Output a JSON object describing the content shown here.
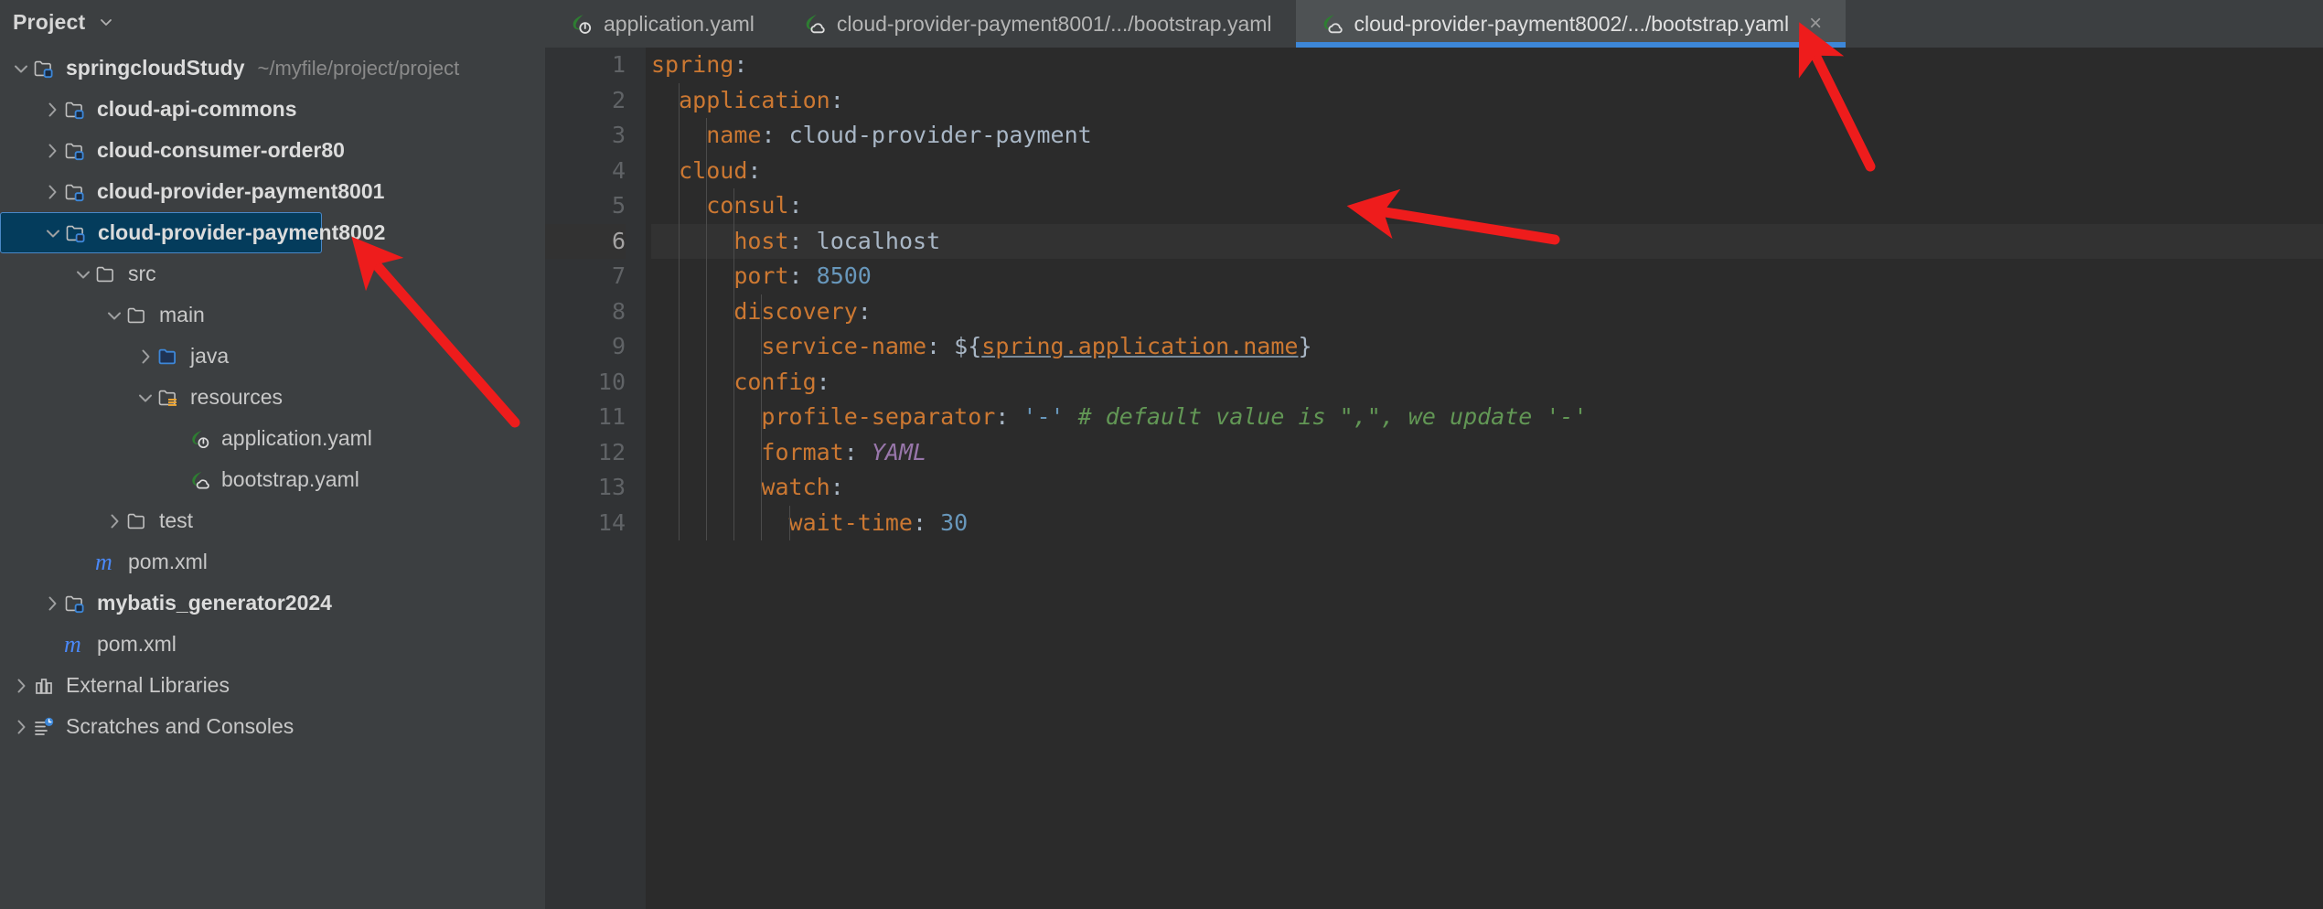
{
  "sidebar": {
    "title": "Project",
    "title_chevron_icon": "chevron-down-icon",
    "tree": [
      {
        "indent": 0,
        "toggle": "chevron-down-icon",
        "icon": "module-folder-icon",
        "label": "springcloudStudy",
        "hint": "~/myfile/project/project",
        "bold": true,
        "selected": false
      },
      {
        "indent": 1,
        "toggle": "chevron-right-icon",
        "icon": "module-folder-icon",
        "label": "cloud-api-commons",
        "hint": "",
        "bold": true,
        "selected": false
      },
      {
        "indent": 1,
        "toggle": "chevron-right-icon",
        "icon": "module-folder-icon",
        "label": "cloud-consumer-order80",
        "hint": "",
        "bold": true,
        "selected": false
      },
      {
        "indent": 1,
        "toggle": "chevron-right-icon",
        "icon": "module-folder-icon",
        "label": "cloud-provider-payment8001",
        "hint": "",
        "bold": true,
        "selected": false
      },
      {
        "indent": 1,
        "toggle": "chevron-down-icon",
        "icon": "module-folder-icon",
        "label": "cloud-provider-payment8002",
        "hint": "",
        "bold": true,
        "selected": true
      },
      {
        "indent": 2,
        "toggle": "chevron-down-icon",
        "icon": "folder-icon",
        "label": "src",
        "hint": "",
        "bold": false,
        "selected": false
      },
      {
        "indent": 3,
        "toggle": "chevron-down-icon",
        "icon": "folder-icon",
        "label": "main",
        "hint": "",
        "bold": false,
        "selected": false
      },
      {
        "indent": 4,
        "toggle": "chevron-right-icon",
        "icon": "source-root-folder-icon",
        "label": "java",
        "hint": "",
        "bold": false,
        "selected": false
      },
      {
        "indent": 4,
        "toggle": "chevron-down-icon",
        "icon": "resources-folder-icon",
        "label": "resources",
        "hint": "",
        "bold": false,
        "selected": false
      },
      {
        "indent": 5,
        "toggle": "none",
        "icon": "spring-boot-yaml-icon",
        "label": "application.yaml",
        "hint": "",
        "bold": false,
        "selected": false
      },
      {
        "indent": 5,
        "toggle": "none",
        "icon": "spring-cloud-yaml-icon",
        "label": "bootstrap.yaml",
        "hint": "",
        "bold": false,
        "selected": false
      },
      {
        "indent": 3,
        "toggle": "chevron-right-icon",
        "icon": "folder-icon",
        "label": "test",
        "hint": "",
        "bold": false,
        "selected": false
      },
      {
        "indent": 2,
        "toggle": "none",
        "icon": "maven-pom-icon",
        "label": "pom.xml",
        "hint": "",
        "bold": false,
        "selected": false
      },
      {
        "indent": 1,
        "toggle": "chevron-right-icon",
        "icon": "module-folder-icon",
        "label": "mybatis_generator2024",
        "hint": "",
        "bold": true,
        "selected": false
      },
      {
        "indent": 1,
        "toggle": "none",
        "icon": "maven-pom-icon",
        "label": "pom.xml",
        "hint": "",
        "bold": false,
        "selected": false
      },
      {
        "indent": 0,
        "toggle": "chevron-right-icon",
        "icon": "external-libraries-icon",
        "label": "External Libraries",
        "hint": "",
        "bold": false,
        "selected": false
      },
      {
        "indent": 0,
        "toggle": "chevron-right-icon",
        "icon": "scratches-icon",
        "label": "Scratches and Consoles",
        "hint": "",
        "bold": false,
        "selected": false
      }
    ]
  },
  "editor": {
    "tabs": [
      {
        "label": "application.yaml",
        "icon": "spring-boot-yaml-icon",
        "active": false,
        "closable": false
      },
      {
        "label": "cloud-provider-payment8001/.../bootstrap.yaml",
        "icon": "spring-cloud-yaml-icon",
        "active": false,
        "closable": false
      },
      {
        "label": "cloud-provider-payment8002/.../bootstrap.yaml",
        "icon": "spring-cloud-yaml-icon",
        "active": true,
        "closable": true,
        "close_icon": "close-icon",
        "close_label": "×"
      }
    ],
    "current_line": 6,
    "line_numbers": [
      1,
      2,
      3,
      4,
      5,
      6,
      7,
      8,
      9,
      10,
      11,
      12,
      13,
      14
    ],
    "lines": [
      {
        "n": 1,
        "indent": 0,
        "key": "spring",
        "colon": ":",
        "value": "",
        "value_type": "none"
      },
      {
        "n": 2,
        "indent": 1,
        "key": "application",
        "colon": ":",
        "value": "",
        "value_type": "none"
      },
      {
        "n": 3,
        "indent": 2,
        "key": "name",
        "colon": ":",
        "value": "cloud-provider-payment",
        "value_type": "plain"
      },
      {
        "n": 4,
        "indent": 1,
        "key": "cloud",
        "colon": ":",
        "value": "",
        "value_type": "none"
      },
      {
        "n": 5,
        "indent": 2,
        "key": "consul",
        "colon": ":",
        "value": "",
        "value_type": "none"
      },
      {
        "n": 6,
        "indent": 3,
        "key": "host",
        "colon": ":",
        "value": "localhost",
        "value_type": "plain"
      },
      {
        "n": 7,
        "indent": 3,
        "key": "port",
        "colon": ":",
        "value": "8500",
        "value_type": "number"
      },
      {
        "n": 8,
        "indent": 3,
        "key": "discovery",
        "colon": ":",
        "value": "",
        "value_type": "none"
      },
      {
        "n": 9,
        "indent": 4,
        "key": "service-name",
        "colon": ":",
        "value": "${spring.application.name}",
        "value_type": "placeholder",
        "placeholder_prefix": "${",
        "placeholder_link": "spring.application.name",
        "placeholder_suffix": "}"
      },
      {
        "n": 10,
        "indent": 3,
        "key": "config",
        "colon": ":",
        "value": "",
        "value_type": "none"
      },
      {
        "n": 11,
        "indent": 4,
        "key": "profile-separator",
        "colon": ":",
        "value": "'-'",
        "value_type": "quoted",
        "comment": "# default value is \",\", we update '-'"
      },
      {
        "n": 12,
        "indent": 4,
        "key": "format",
        "colon": ":",
        "value": "YAML",
        "value_type": "literal"
      },
      {
        "n": 13,
        "indent": 4,
        "key": "watch",
        "colon": ":",
        "value": "",
        "value_type": "none"
      },
      {
        "n": 14,
        "indent": 5,
        "key": "wait-time",
        "colon": ":",
        "value": "30",
        "value_type": "number"
      }
    ]
  },
  "annotations": {
    "arrow_to_tab": {
      "name": "red-arrow-to-active-tab"
    },
    "arrow_to_module": {
      "name": "red-arrow-to-selected-module"
    },
    "arrow_to_name_value": {
      "name": "red-arrow-to-app-name-value"
    },
    "color": "#ee1c1c"
  },
  "colors": {
    "sidebar_bg": "#3c3f41",
    "editor_bg": "#2b2b2b",
    "gutter_bg": "#313335",
    "selection_bg": "#043c5c",
    "selection_border": "#4a88c7",
    "tab_active_bg": "#4e5254",
    "tab_underline": "#3d87d8",
    "key_color": "#cc7832",
    "value_color": "#a9b7c6",
    "number_color": "#6897bb",
    "comment_color": "#629755",
    "literal_color": "#9876aa",
    "annotation_red": "#ee1c1c"
  }
}
